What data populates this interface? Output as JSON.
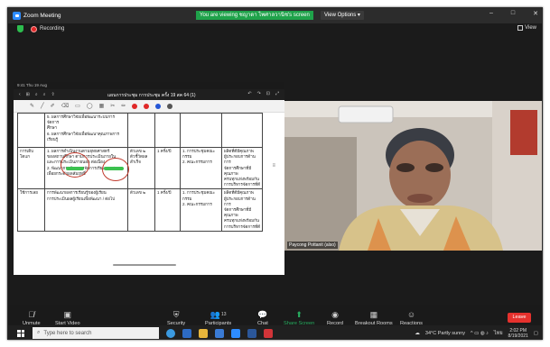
{
  "window": {
    "title": "Zoom Meeting",
    "share_banner": "You are viewing ชญาดา ไพศาลวานิช's screen",
    "view_options": "View Options",
    "minimize": "–",
    "maximize": "□",
    "close": "✕"
  },
  "status": {
    "recording": "Recording",
    "view": "View"
  },
  "document": {
    "topbar_text": "9:41  Thu 19 Aug",
    "title": "แผนการประชุม การประชุม ครั้ง 19 สค 64 (1)",
    "nav": [
      "‹",
      "⊞",
      "⌕",
      "⌕",
      "⇧"
    ],
    "right_icons": [
      "↶",
      "↷",
      "⊡",
      "⤢"
    ],
    "tools": [
      "✎",
      "╱",
      "✐",
      "⌫",
      "▭",
      "◯",
      "▦",
      "✂",
      "✏"
    ],
    "tool_colors": [
      "#e02828",
      "#e02828",
      "#2456d6",
      "#555555"
    ],
    "table_rows": [
      {
        "c1": "",
        "c2": "5. ผลการศึกษาวิจัยเพื่อพัฒนาระบบการจัดการ\nศึกษา\n6. ผลการศึกษาวิจัยเพื่อพัฒนาคุณภาพการ\nเรียนรู้",
        "c3": "",
        "c4": "",
        "c5": "",
        "c6": ""
      },
      {
        "c1": "การเติบ\nโตแก",
        "c2": "1. ผลการดำเนินงานตามยุทธศาสตร์\nของสถานศึกษา ตามการประเมินภายใน\nและการประเมินภายนอก ต่อเนื่อง\n2. พัฒนาการด้านการจัดการเรียนการสอน\nเพื่อยกระดับผลสัมฤทธิ์",
        "c3": "ตัวเลข ๒\nตัวชี้วัดผลสำเร็จ",
        "c4": "1 ครั้ง/ปี",
        "c5": "1. การประชุมคณะกรรม\n2. คณะกรรมการ",
        "c6": "ผลิตที่ดีมีคุณภาพ\nผู้ประกอบการด้านการ\nจัดการศึกษาที่มีคุณภาพ\nครบทุกแห่งพร้อมกัน\nการบริหารจัดการที่ดี"
      },
      {
        "c1": "ใช้การเลย",
        "c2": "การพัฒนาผลการเรียนรู้ของผู้เรียน\nการประเมินผลผู้เรียนเพื่อพัฒนา / ต่อไป",
        "c3": "ตัวเลข ๒",
        "c4": "1 ครั้ง/ปี",
        "c5": "1. การประชุมคณะกรรม\n2. คณะกรรมการ",
        "c6": "ผลิตที่ดีมีคุณภาพ\nผู้ประกอบการด้านการ\nจัดการศึกษาที่มีคุณภาพ\nครบทุกแห่งพร้อมกัน\nการบริหารจัดการที่ดี"
      }
    ]
  },
  "camera": {
    "participant_name": "Paycong Pottanit (also)"
  },
  "toolbar": {
    "items": [
      {
        "label": "Unmute",
        "icon": "mic-muted-icon"
      },
      {
        "label": "Start Video",
        "icon": "video-off-icon"
      },
      {
        "label": "Security",
        "icon": "shield-icon"
      },
      {
        "label": "Participants",
        "icon": "participants-icon",
        "count": "13"
      },
      {
        "label": "Chat",
        "icon": "chat-icon"
      },
      {
        "label": "Share Screen",
        "icon": "share-screen-icon"
      },
      {
        "label": "Record",
        "icon": "record-icon"
      },
      {
        "label": "Breakout Rooms",
        "icon": "breakout-rooms-icon"
      },
      {
        "label": "Reactions",
        "icon": "reactions-icon"
      }
    ],
    "leave": "Leave"
  },
  "taskbar": {
    "search_placeholder": "Type here to search",
    "weather": "34°C  Partly sunny",
    "lang": "ไทย",
    "time": "2:02 PM",
    "date": "8/19/2021"
  },
  "colors": {
    "zoom_green": "#27ae60",
    "leave_red": "#e5312d",
    "zoom_blue": "#2d8cff"
  }
}
